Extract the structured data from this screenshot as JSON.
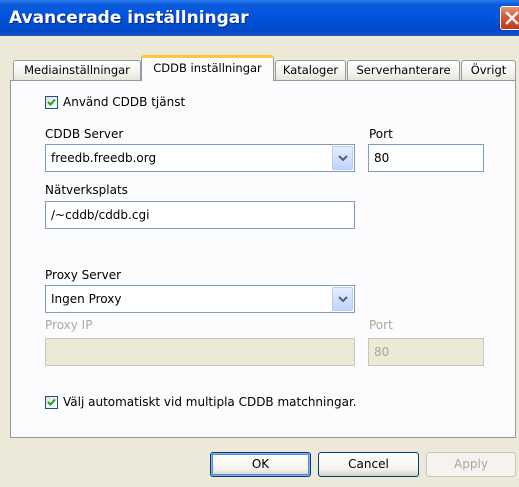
{
  "window": {
    "title": "Avancerade inställningar"
  },
  "tabs": [
    {
      "label": "Mediainställningar"
    },
    {
      "label": "CDDB inställningar"
    },
    {
      "label": "Kataloger"
    },
    {
      "label": "Serverhanterare"
    },
    {
      "label": "Övrigt"
    }
  ],
  "cddb": {
    "use_label": "Använd CDDB tjänst",
    "use_checked": true,
    "server_label": "CDDB Server",
    "server_value": "freedb.freedb.org",
    "port_label": "Port",
    "port_value": "80",
    "location_label": "Nätverksplats",
    "location_value": "/~cddb/cddb.cgi"
  },
  "proxy": {
    "server_label": "Proxy Server",
    "server_value": "Ingen Proxy",
    "ip_label": "Proxy IP",
    "ip_value": "",
    "port_label": "Port",
    "port_value": "80"
  },
  "auto_select": {
    "label": "Välj automatiskt vid multipla CDDB matchningar.",
    "checked": true
  },
  "buttons": {
    "ok": "OK",
    "cancel": "Cancel",
    "apply": "Apply"
  },
  "colors": {
    "titlebar": "#0254E0",
    "dialog_bg": "#ECE9D8",
    "panel_bg": "#FCFCFE",
    "active_tab_accent": "#FFC83C",
    "checkmark": "#21A121",
    "close_button": "#D5583A"
  },
  "icons": {
    "close": "close-icon",
    "dropdown": "chevron-down-icon",
    "check": "checkmark-icon"
  }
}
